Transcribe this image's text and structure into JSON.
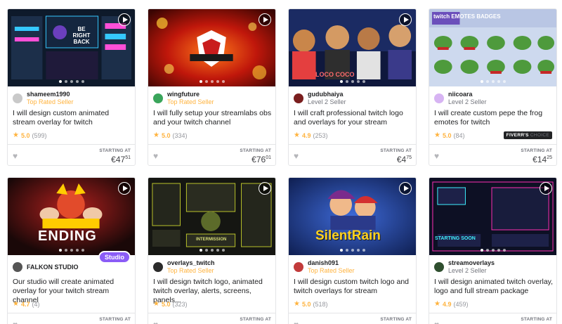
{
  "currency": "€",
  "starting_at_label": "STARTING AT",
  "gigs": [
    {
      "seller": "shameem1990",
      "level": "Top Rated Seller",
      "top": true,
      "title": "I will design custom animated stream overlay for twitch",
      "rating": "5.0",
      "reviews": "(599)",
      "price_main": "€47",
      "price_cents": "51",
      "thumb_text": "BE RIGHT BACK",
      "theme": "#0e1a2b",
      "accent": "#35c8ff",
      "avatar_color": "#c9c9c9"
    },
    {
      "seller": "wingfuture",
      "level": "Top Rated Seller",
      "top": true,
      "title": "I will fully setup your streamlabs obs and your twitch channel",
      "rating": "5.0",
      "reviews": "(334)",
      "price_main": "€76",
      "price_cents": "01",
      "thumb_text": "",
      "theme": "#c0170b",
      "accent": "#ff9a1f",
      "avatar_color": "#3aa55b"
    },
    {
      "seller": "gudubhaiya",
      "level": "Level 2 Seller",
      "top": false,
      "title": "I will craft professional twitch logo and overlays for your stream",
      "rating": "4.9",
      "reviews": "(253)",
      "price_main": "€4",
      "price_cents": "75",
      "thumb_text": "LOCO COCO",
      "theme": "#1b2b63",
      "accent": "#e43f3f",
      "avatar_color": "#7a1e1e"
    },
    {
      "seller": "niicoara",
      "level": "Level 2 Seller",
      "top": false,
      "title": "I will create custom pepe the frog emotes for twitch",
      "rating": "5.0",
      "reviews": "(84)",
      "price_main": "€14",
      "price_cents": "25",
      "thumb_text": "twitch EMOTES BADGES",
      "choice": true,
      "choice_brand": "FIVERR'S",
      "choice_label": "CHOICE",
      "theme": "#cdd9ee",
      "accent": "#6b4fbb",
      "avatar_color": "#d7b4f3"
    },
    {
      "seller": "FALKON STUDIO",
      "level": "",
      "top": false,
      "title": "Our studio will create animated overlay for your twitch stream channel",
      "rating": "4.7",
      "reviews": "(4)",
      "price_main": "",
      "price_cents": "",
      "thumb_text": "ENDING",
      "studio": true,
      "studio_label": "Studio",
      "theme": "#1a0808",
      "accent": "#ffcc00",
      "avatar_color": "#555555"
    },
    {
      "seller": "overlays_twitch",
      "level": "Top Rated Seller",
      "top": true,
      "title": "I will design twitch logo, animated twitch overlay, alerts, screens, panels...",
      "rating": "5.0",
      "reviews": "(323)",
      "price_main": "",
      "price_cents": "",
      "thumb_text": "INTERMISSION",
      "theme": "#151612",
      "accent": "#b9c22a",
      "avatar_color": "#2b2b2b"
    },
    {
      "seller": "danish091",
      "level": "Top Rated Seller",
      "top": true,
      "title": "I will design custom twitch logo and twitch overlays for stream",
      "rating": "5.0",
      "reviews": "(518)",
      "price_main": "",
      "price_cents": "",
      "thumb_text": "SilentRain",
      "theme": "#1b3a8a",
      "accent": "#ffd21f",
      "avatar_color": "#c23b3b"
    },
    {
      "seller": "streamoverlays",
      "level": "Level 2 Seller",
      "top": false,
      "title": "I will design animated twitch overlay, logo and full stream package",
      "rating": "4.9",
      "reviews": "(459)",
      "price_main": "",
      "price_cents": "",
      "thumb_text": "STARTING SOON",
      "theme": "#0d1024",
      "accent": "#ff2fb4",
      "avatar_color": "#2f4f2f"
    }
  ]
}
